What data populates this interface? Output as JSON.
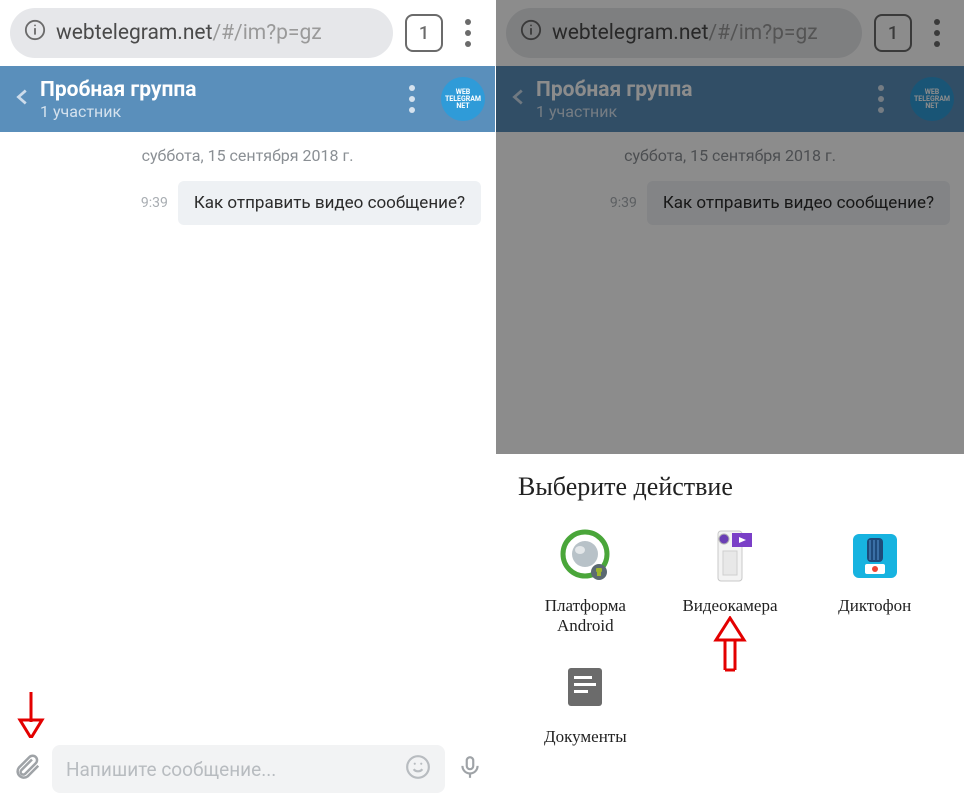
{
  "browser": {
    "url_host": "webtelegram.net",
    "url_path": "/#/im?p=gz",
    "tab_count": "1"
  },
  "chat": {
    "title": "Пробная группа",
    "subtitle": "1 участник",
    "avatar_text": "WEB TELEGRAM NET",
    "date_separator": "суббота, 15 сентября 2018 г.",
    "messages": [
      {
        "time": "9:39",
        "text": "Как отправить видео сообщение?"
      }
    ],
    "input_placeholder": "Напишите сообщение..."
  },
  "sheet": {
    "title": "Выберите действие",
    "items": [
      {
        "label": "Платформа Android",
        "icon": "android"
      },
      {
        "label": "Видеокамера",
        "icon": "camera"
      },
      {
        "label": "Диктофон",
        "icon": "dictaphone"
      },
      {
        "label": "Документы",
        "icon": "documents"
      }
    ]
  },
  "annotations": {
    "left_arrow": "red-arrow-down",
    "right_arrow": "red-arrow-up"
  }
}
